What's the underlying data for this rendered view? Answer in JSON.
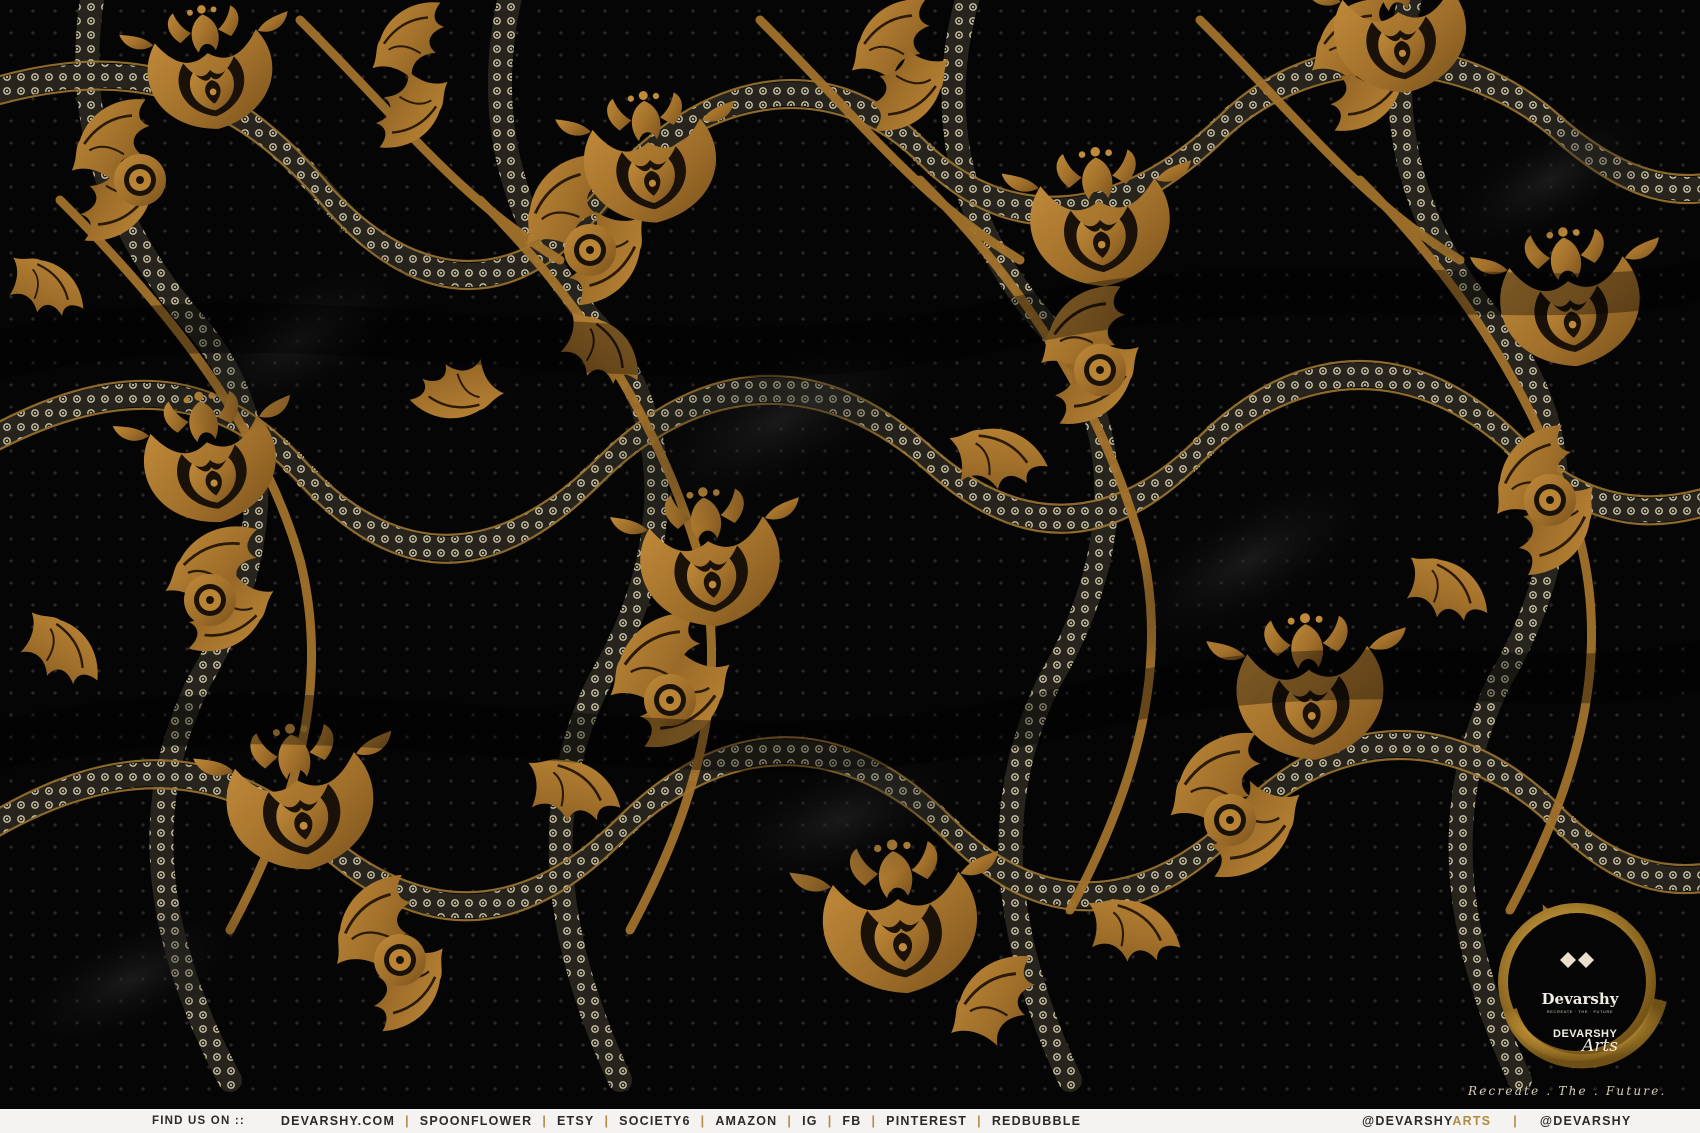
{
  "footer": {
    "find_us": "FIND US ON ::",
    "links": [
      "DEVARSHY.COM",
      "SPOONFLOWER",
      "ETSY",
      "SOCIETY6",
      "AMAZON",
      "IG",
      "FB",
      "PINTEREST",
      "REDBUBBLE"
    ],
    "handle_primary_a": "@DEVARSHY",
    "handle_primary_b": "ARTS",
    "handle_secondary": "@DEVARSHY"
  },
  "logo": {
    "name": "Devarshy",
    "sub": "RECREATE · THE · FUTURE",
    "brand": "DEVARSHY",
    "script": "Arts",
    "tagline": "Recreate . The . Future."
  },
  "colors": {
    "background": "#050505",
    "gold": "#a8762e",
    "gold_dark": "#7d5620",
    "lace": "#cbc3a3",
    "footer_bg": "#f4f3f1",
    "footer_text": "#2a2a2a"
  }
}
